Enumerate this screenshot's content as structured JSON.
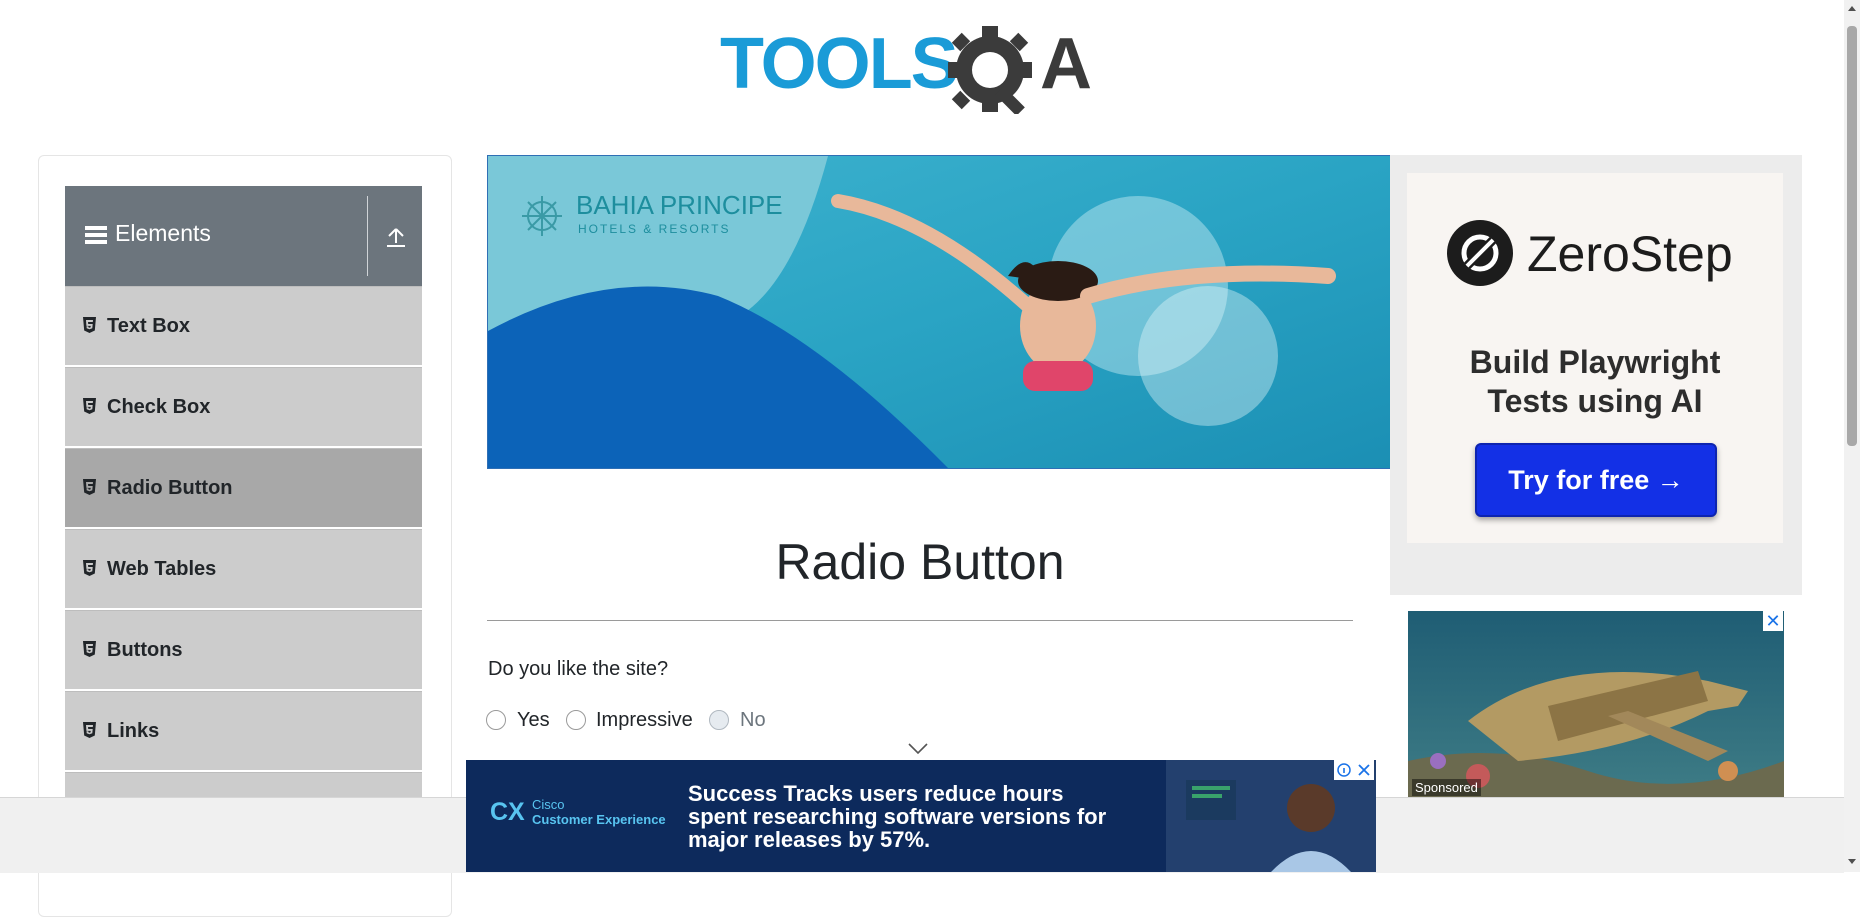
{
  "logo": {
    "text_left": "TOOLS",
    "text_right": "A"
  },
  "sidebar": {
    "group_title": "Elements",
    "items": [
      {
        "label": "Text Box"
      },
      {
        "label": "Check Box"
      },
      {
        "label": "Radio Button",
        "active": true
      },
      {
        "label": "Web Tables"
      },
      {
        "label": "Buttons"
      },
      {
        "label": "Links"
      },
      {
        "label": ""
      }
    ]
  },
  "banner_ad": {
    "brand": "BAHIA PRINCIPE",
    "sub": "HOTELS & RESORTS"
  },
  "right_ad": {
    "brand": "ZeroStep",
    "tagline_line1": "Build Playwright",
    "tagline_line2": "Tests using AI",
    "cta": "Try for free →"
  },
  "side_ad": {
    "sponsored": "Sponsored",
    "close": "✕"
  },
  "main": {
    "title": "Radio Button",
    "question": "Do you like the site?",
    "options": [
      {
        "label": "Yes",
        "disabled": false
      },
      {
        "label": "Impressive",
        "disabled": false
      },
      {
        "label": "No",
        "disabled": true
      }
    ]
  },
  "bottom_ad": {
    "logo": "CX",
    "brand_line1": "Cisco",
    "brand_line2": "Customer Experience",
    "message": "Success Tracks users reduce hours spent researching software versions for major releases by 57%."
  },
  "colors": {
    "sidebar_header": "#6c757d",
    "sidebar_item": "#cccccc",
    "sidebar_item_active": "#a8a8a8",
    "logo_blue": "#1a9bd7",
    "logo_dark": "#3b3b3b",
    "cta_blue": "#1330e6"
  }
}
